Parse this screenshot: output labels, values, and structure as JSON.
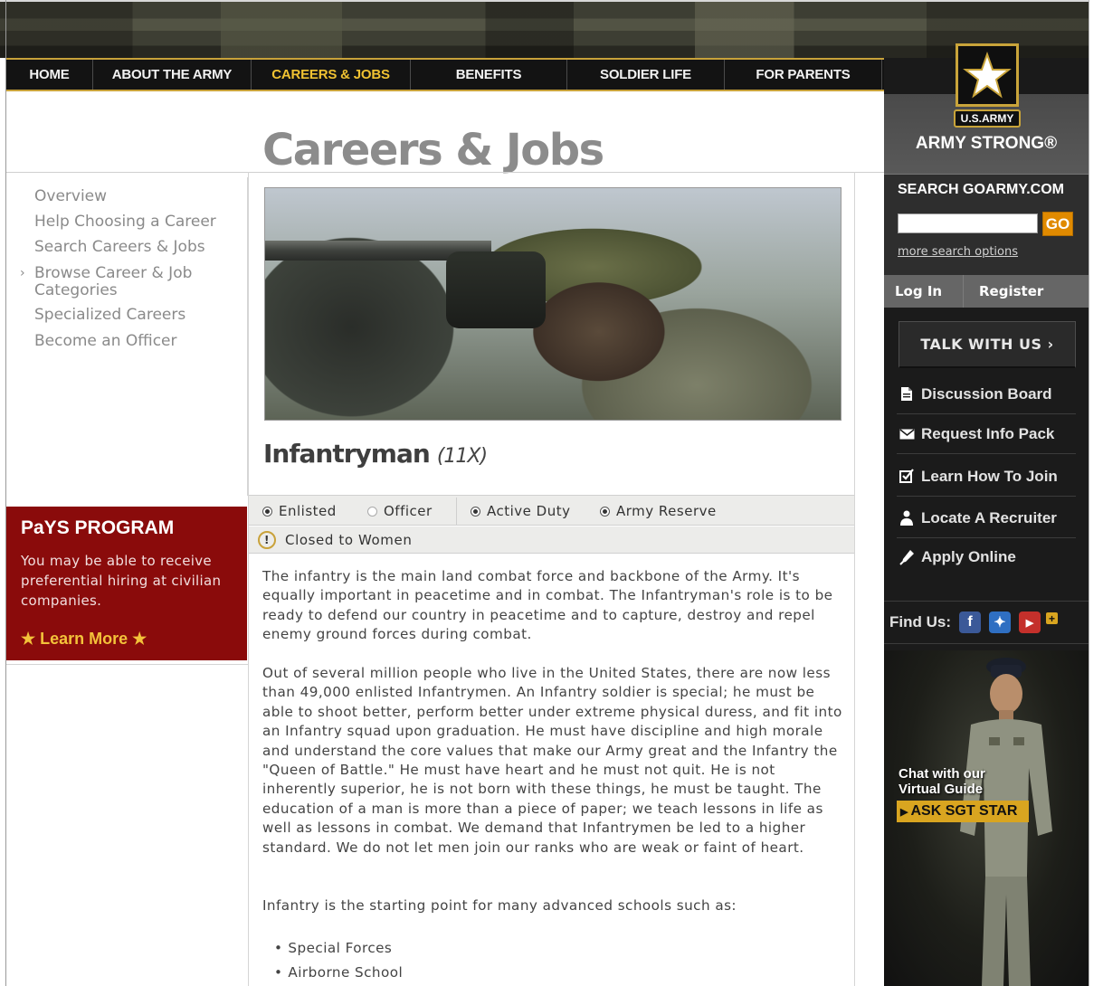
{
  "nav": {
    "items": [
      {
        "label": "HOME"
      },
      {
        "label": "ABOUT THE ARMY"
      },
      {
        "label": "CAREERS & JOBS"
      },
      {
        "label": "BENEFITS"
      },
      {
        "label": "SOLDIER LIFE"
      },
      {
        "label": "FOR PARENTS"
      }
    ],
    "active_index": 2
  },
  "brand": {
    "plate": "U.S.ARMY",
    "slogan": "ARMY STRONG®"
  },
  "search": {
    "title": "SEARCH GOARMY.COM",
    "value": "",
    "go_label": "GO",
    "more_options": "more search options"
  },
  "auth": {
    "login": "Log In",
    "register": "Register"
  },
  "talk": {
    "label": "TALK WITH US ›"
  },
  "sidebar_links": [
    {
      "label": "Discussion Board",
      "icon": "document-icon"
    },
    {
      "label": "Request Info Pack",
      "icon": "envelope-icon"
    },
    {
      "label": "Learn How To Join",
      "icon": "checkbox-icon"
    },
    {
      "label": "Locate A Recruiter",
      "icon": "person-icon"
    },
    {
      "label": "Apply Online",
      "icon": "pen-icon"
    }
  ],
  "find_us": {
    "label": "Find Us:",
    "networks": [
      {
        "name": "facebook-icon",
        "glyph": "f",
        "color": "#3b5998"
      },
      {
        "name": "myspace-icon",
        "glyph": "✦",
        "color": "#2f6fc2"
      },
      {
        "name": "youtube-icon",
        "glyph": "▶",
        "color": "#c4302b"
      }
    ],
    "more": "+"
  },
  "sgt_star": {
    "chat_line1": "Chat with our",
    "chat_line2": "Virtual Guide",
    "ask_label": "ASK SGT STAR"
  },
  "page": {
    "title": "Careers & Jobs"
  },
  "leftnav": {
    "items": [
      {
        "label": "Overview"
      },
      {
        "label": "Help Choosing a Career"
      },
      {
        "label": "Search Careers & Jobs"
      },
      {
        "label": "Browse Career & Job Categories"
      },
      {
        "label": "Specialized Careers"
      },
      {
        "label": "Become an Officer"
      }
    ],
    "caret": "›"
  },
  "pays": {
    "title": "PaYS PROGRAM",
    "text": "You may be able to receive preferential hiring at civilian companies.",
    "learn_more": "★ Learn More ★"
  },
  "job": {
    "title": "Infantryman",
    "code": "(11X)",
    "filters": {
      "enlisted": "Enlisted",
      "officer": "Officer",
      "active_duty": "Active Duty",
      "army_reserve": "Army Reserve"
    },
    "restriction": "Closed to Women",
    "paragraphs": [
      "The infantry is the main land combat force and backbone of the Army. It's equally important in peacetime and in combat. The Infantryman's role is to be ready to defend our country in peacetime and to capture, destroy and repel enemy ground forces during combat.",
      "Out of several million people who live in the United States, there are now less than 49,000 enlisted Infantrymen. An Infantry soldier is special; he must be able to shoot better, perform better under extreme physical duress, and fit into an Infantry squad upon graduation. He must have discipline and high morale and understand the core values that make our Army great and the Infantry the \"Queen of Battle.\" He must have heart and he must not quit. He is not inherently superior, he is not born with these things, he must be taught. The education of a man is more than a piece of paper; we teach lessons in life as well as lessons in combat. We demand that Infantrymen be led to a higher standard. We do not let men join our ranks who are weak or faint of heart.",
      "Infantry is the starting point for many advanced schools such as:"
    ],
    "schools": [
      "Special Forces",
      "Airborne School"
    ]
  }
}
